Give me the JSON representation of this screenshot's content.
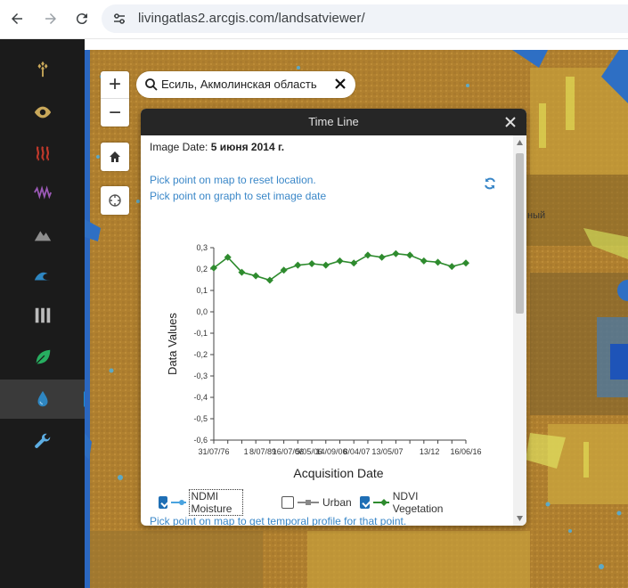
{
  "browser": {
    "url": "livingatlas2.arcgis.com/landsatviewer/"
  },
  "sidebar": {
    "items": [
      {
        "icon": "wheat-icon",
        "color": "#c9a85a"
      },
      {
        "icon": "eye-icon",
        "color": "#c9a85a"
      },
      {
        "icon": "heat-icon",
        "color": "#c0392b"
      },
      {
        "icon": "wave-icon",
        "color": "#9b59b6"
      },
      {
        "icon": "mountain-icon",
        "color": "#8e8e8e"
      },
      {
        "icon": "ocean-wave-icon",
        "color": "#2e86c1"
      },
      {
        "icon": "bars-icon",
        "color": "#bbbbbb"
      },
      {
        "icon": "leaf-icon",
        "color": "#27ae60"
      },
      {
        "icon": "water-drop-icon",
        "color": "#2e86c1",
        "active": true
      },
      {
        "icon": "wrench-icon",
        "color": "#5dade2"
      }
    ]
  },
  "map": {
    "search": {
      "value": "Есиль, Акмолинская область"
    },
    "label_partial": "ный"
  },
  "panel": {
    "title": "Time Line",
    "image_date_label": "Image Date:",
    "image_date_value": "5 июня 2014 г.",
    "link_reset": "Pick point on map to reset location.",
    "link_set_date": "Pick point on graph to set image date",
    "link_profile": "Pick point on map to get temporal profile for that point."
  },
  "chart_data": {
    "type": "line",
    "xlabel": "Acquisition Date",
    "ylabel": "Data Values",
    "ylim": [
      -0.6,
      0.3
    ],
    "y_ticks": [
      "0,3",
      "0,2",
      "0,1",
      "0,0",
      "-0,1",
      "-0,2",
      "-0,3",
      "-0,4",
      "-0,5",
      "-0,6"
    ],
    "x_tick_labels": [
      "31/07/76",
      "1",
      "8/07/89",
      "16/07/06",
      "5/05/06",
      "14/09/06",
      "8/04/07",
      "13/05/07",
      "13/12",
      "16/06/16"
    ],
    "series": [
      {
        "name": "NDVI Vegetation",
        "color": "#2e8b2e",
        "values": [
          0.205,
          0.255,
          0.185,
          0.168,
          0.148,
          0.195,
          0.218,
          0.225,
          0.218,
          0.238,
          0.228,
          0.265,
          0.255,
          0.272,
          0.265,
          0.238,
          0.232,
          0.212,
          0.228
        ]
      }
    ],
    "legend": [
      {
        "label": "NDMI Moisture",
        "checked": true,
        "color": "#4aa3df"
      },
      {
        "label": "Urban",
        "checked": false,
        "color": "#888888"
      },
      {
        "label": "NDVI Vegetation",
        "checked": true,
        "color": "#2e8b2e"
      }
    ]
  }
}
